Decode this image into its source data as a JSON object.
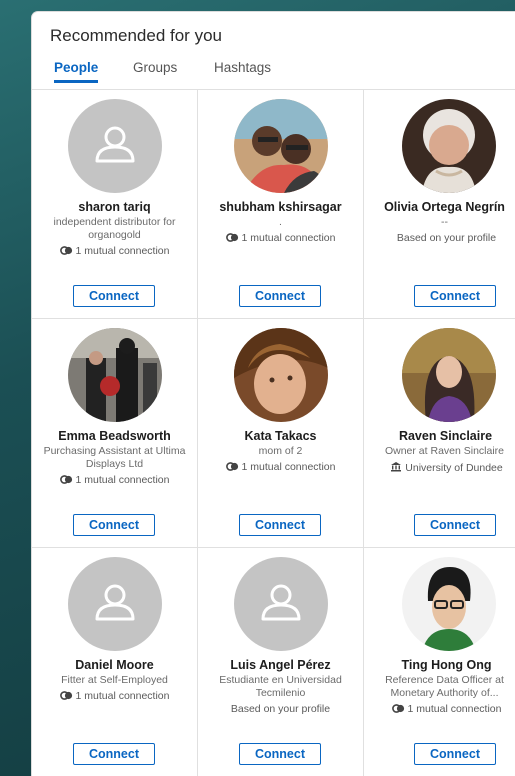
{
  "panel": {
    "title": "Recommended for you"
  },
  "tabs": [
    {
      "label": "People"
    },
    {
      "label": "Groups"
    },
    {
      "label": "Hashtags"
    }
  ],
  "accent_color": "#0a66c2",
  "cards": [
    {
      "name": "sharon tariq",
      "sub": "independent distributor for organogold",
      "meta": "1 mutual connection",
      "meta_icon": "mutual-connection-icon",
      "avatar": "placeholder",
      "button": "Connect"
    },
    {
      "name": "shubham kshirsagar",
      "sub": ".",
      "meta": "1 mutual connection",
      "meta_icon": "mutual-connection-icon",
      "avatar": "photo",
      "button": "Connect"
    },
    {
      "name": "Olivia Ortega Negrín",
      "sub": "--",
      "meta": "Based on your profile",
      "meta_icon": "",
      "avatar": "photo",
      "button": "Connect"
    },
    {
      "name": "Emma Beadsworth",
      "sub": "Purchasing Assistant at Ultima Displays Ltd",
      "meta": "1 mutual connection",
      "meta_icon": "mutual-connection-icon",
      "avatar": "photo",
      "button": "Connect"
    },
    {
      "name": "Kata Takacs",
      "sub": "mom of 2",
      "meta": "1 mutual connection",
      "meta_icon": "mutual-connection-icon",
      "avatar": "photo",
      "button": "Connect"
    },
    {
      "name": "Raven Sinclaire",
      "sub": "Owner at Raven Sinclaire",
      "meta": "University of Dundee",
      "meta_icon": "university-icon",
      "avatar": "photo",
      "button": "Connect"
    },
    {
      "name": "Daniel Moore",
      "sub": "Fitter at Self-Employed",
      "meta": "1 mutual connection",
      "meta_icon": "mutual-connection-icon",
      "avatar": "placeholder",
      "button": "Connect"
    },
    {
      "name": "Luis Angel Pérez",
      "sub": "Estudiante en Universidad Tecmilenio",
      "meta": "Based on your profile",
      "meta_icon": "",
      "avatar": "placeholder",
      "button": "Connect"
    },
    {
      "name": "Ting Hong Ong",
      "sub": "Reference Data Officer at Monetary Authority of...",
      "meta": "1 mutual connection",
      "meta_icon": "mutual-connection-icon",
      "avatar": "photo",
      "button": "Connect"
    }
  ]
}
